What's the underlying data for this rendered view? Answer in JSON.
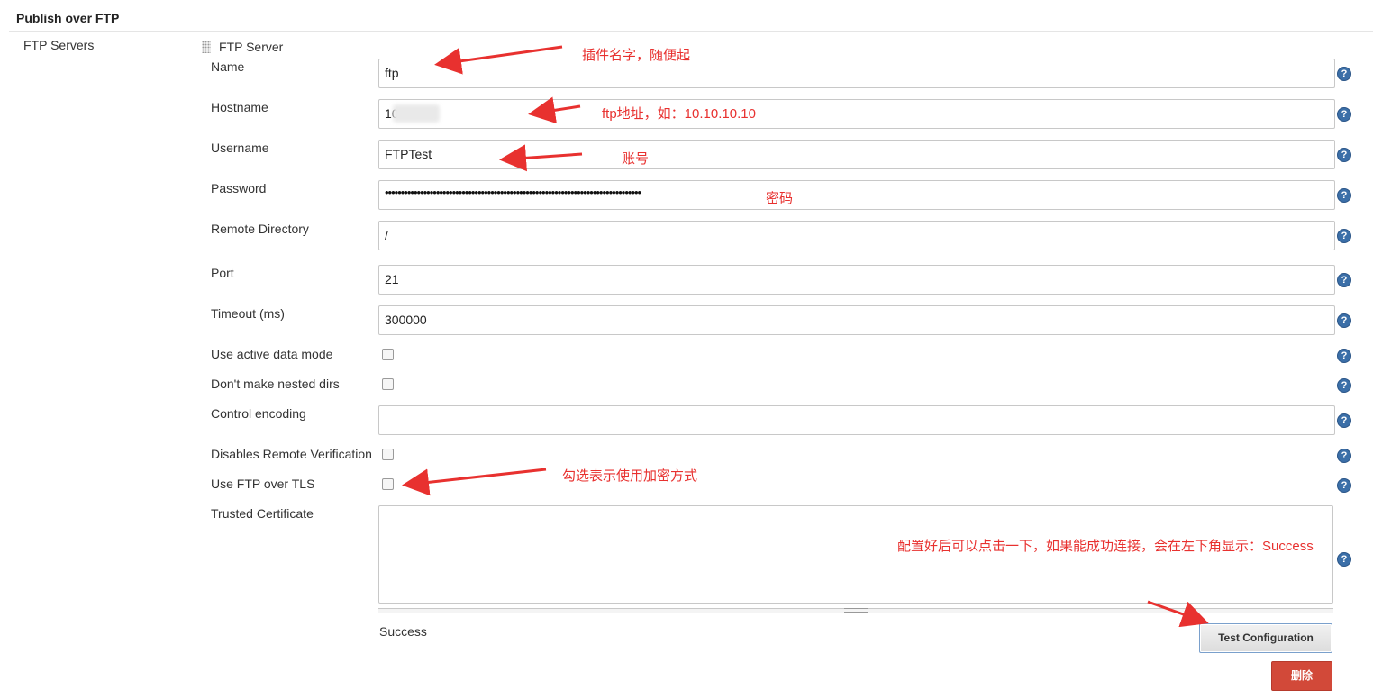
{
  "section": {
    "title": "Publish over FTP"
  },
  "servers": {
    "label": "FTP Servers",
    "server_title": "FTP Server"
  },
  "fields": {
    "name": {
      "label": "Name",
      "value": "ftp"
    },
    "hostname": {
      "label": "Hostname",
      "value": "10"
    },
    "username": {
      "label": "Username",
      "value": "FTPTest"
    },
    "password": {
      "label": "Password",
      "value": "••••••••••••••••••••••••••••••••••••••••••••••••••••••••••••••••••••••••••••••••"
    },
    "remote_dir": {
      "label": "Remote Directory",
      "value": "/"
    },
    "port": {
      "label": "Port",
      "value": "21"
    },
    "timeout": {
      "label": "Timeout (ms)",
      "value": "300000"
    },
    "active_mode": {
      "label": "Use active data mode",
      "checked": false
    },
    "nested_dirs": {
      "label": "Don't make nested dirs",
      "checked": false
    },
    "encoding": {
      "label": "Control encoding",
      "value": ""
    },
    "disable_verify": {
      "label": "Disables Remote Verification",
      "checked": false
    },
    "tls": {
      "label": "Use FTP over TLS",
      "checked": false
    },
    "trusted_cert": {
      "label": "Trusted Certificate",
      "value": ""
    }
  },
  "status": {
    "text": "Success"
  },
  "buttons": {
    "test": "Test Configuration",
    "delete": "删除"
  },
  "help_icon": {
    "glyph": "?",
    "name": "help-icon"
  },
  "annotations": {
    "name": "插件名字，随便起",
    "hostname": "ftp地址，如：10.10.10.10",
    "username": "账号",
    "password": "密码",
    "tls": "勾选表示使用加密方式",
    "test": "配置好后可以点击一下，如果能成功连接，会在左下角显示：Success",
    "color": "#e8312f"
  }
}
